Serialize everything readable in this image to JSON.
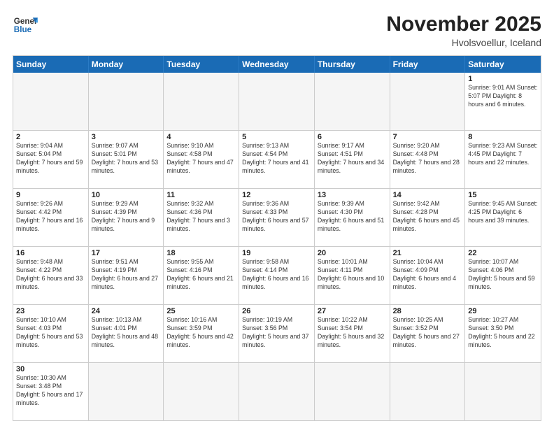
{
  "header": {
    "logo_general": "General",
    "logo_blue": "Blue",
    "month_title": "November 2025",
    "location": "Hvolsvoellur, Iceland"
  },
  "weekdays": [
    "Sunday",
    "Monday",
    "Tuesday",
    "Wednesday",
    "Thursday",
    "Friday",
    "Saturday"
  ],
  "rows": [
    [
      {
        "day": "",
        "empty": true,
        "info": ""
      },
      {
        "day": "",
        "empty": true,
        "info": ""
      },
      {
        "day": "",
        "empty": true,
        "info": ""
      },
      {
        "day": "",
        "empty": true,
        "info": ""
      },
      {
        "day": "",
        "empty": true,
        "info": ""
      },
      {
        "day": "",
        "empty": true,
        "info": ""
      },
      {
        "day": "1",
        "info": "Sunrise: 9:01 AM\nSunset: 5:07 PM\nDaylight: 8 hours\nand 6 minutes."
      }
    ],
    [
      {
        "day": "2",
        "info": "Sunrise: 9:04 AM\nSunset: 5:04 PM\nDaylight: 7 hours\nand 59 minutes."
      },
      {
        "day": "3",
        "info": "Sunrise: 9:07 AM\nSunset: 5:01 PM\nDaylight: 7 hours\nand 53 minutes."
      },
      {
        "day": "4",
        "info": "Sunrise: 9:10 AM\nSunset: 4:58 PM\nDaylight: 7 hours\nand 47 minutes."
      },
      {
        "day": "5",
        "info": "Sunrise: 9:13 AM\nSunset: 4:54 PM\nDaylight: 7 hours\nand 41 minutes."
      },
      {
        "day": "6",
        "info": "Sunrise: 9:17 AM\nSunset: 4:51 PM\nDaylight: 7 hours\nand 34 minutes."
      },
      {
        "day": "7",
        "info": "Sunrise: 9:20 AM\nSunset: 4:48 PM\nDaylight: 7 hours\nand 28 minutes."
      },
      {
        "day": "8",
        "info": "Sunrise: 9:23 AM\nSunset: 4:45 PM\nDaylight: 7 hours\nand 22 minutes."
      }
    ],
    [
      {
        "day": "9",
        "info": "Sunrise: 9:26 AM\nSunset: 4:42 PM\nDaylight: 7 hours\nand 16 minutes."
      },
      {
        "day": "10",
        "info": "Sunrise: 9:29 AM\nSunset: 4:39 PM\nDaylight: 7 hours\nand 9 minutes."
      },
      {
        "day": "11",
        "info": "Sunrise: 9:32 AM\nSunset: 4:36 PM\nDaylight: 7 hours\nand 3 minutes."
      },
      {
        "day": "12",
        "info": "Sunrise: 9:36 AM\nSunset: 4:33 PM\nDaylight: 6 hours\nand 57 minutes."
      },
      {
        "day": "13",
        "info": "Sunrise: 9:39 AM\nSunset: 4:30 PM\nDaylight: 6 hours\nand 51 minutes."
      },
      {
        "day": "14",
        "info": "Sunrise: 9:42 AM\nSunset: 4:28 PM\nDaylight: 6 hours\nand 45 minutes."
      },
      {
        "day": "15",
        "info": "Sunrise: 9:45 AM\nSunset: 4:25 PM\nDaylight: 6 hours\nand 39 minutes."
      }
    ],
    [
      {
        "day": "16",
        "info": "Sunrise: 9:48 AM\nSunset: 4:22 PM\nDaylight: 6 hours\nand 33 minutes."
      },
      {
        "day": "17",
        "info": "Sunrise: 9:51 AM\nSunset: 4:19 PM\nDaylight: 6 hours\nand 27 minutes."
      },
      {
        "day": "18",
        "info": "Sunrise: 9:55 AM\nSunset: 4:16 PM\nDaylight: 6 hours\nand 21 minutes."
      },
      {
        "day": "19",
        "info": "Sunrise: 9:58 AM\nSunset: 4:14 PM\nDaylight: 6 hours\nand 16 minutes."
      },
      {
        "day": "20",
        "info": "Sunrise: 10:01 AM\nSunset: 4:11 PM\nDaylight: 6 hours\nand 10 minutes."
      },
      {
        "day": "21",
        "info": "Sunrise: 10:04 AM\nSunset: 4:09 PM\nDaylight: 6 hours\nand 4 minutes."
      },
      {
        "day": "22",
        "info": "Sunrise: 10:07 AM\nSunset: 4:06 PM\nDaylight: 5 hours\nand 59 minutes."
      }
    ],
    [
      {
        "day": "23",
        "info": "Sunrise: 10:10 AM\nSunset: 4:03 PM\nDaylight: 5 hours\nand 53 minutes."
      },
      {
        "day": "24",
        "info": "Sunrise: 10:13 AM\nSunset: 4:01 PM\nDaylight: 5 hours\nand 48 minutes."
      },
      {
        "day": "25",
        "info": "Sunrise: 10:16 AM\nSunset: 3:59 PM\nDaylight: 5 hours\nand 42 minutes."
      },
      {
        "day": "26",
        "info": "Sunrise: 10:19 AM\nSunset: 3:56 PM\nDaylight: 5 hours\nand 37 minutes."
      },
      {
        "day": "27",
        "info": "Sunrise: 10:22 AM\nSunset: 3:54 PM\nDaylight: 5 hours\nand 32 minutes."
      },
      {
        "day": "28",
        "info": "Sunrise: 10:25 AM\nSunset: 3:52 PM\nDaylight: 5 hours\nand 27 minutes."
      },
      {
        "day": "29",
        "info": "Sunrise: 10:27 AM\nSunset: 3:50 PM\nDaylight: 5 hours\nand 22 minutes."
      }
    ],
    [
      {
        "day": "30",
        "info": "Sunrise: 10:30 AM\nSunset: 3:48 PM\nDaylight: 5 hours\nand 17 minutes."
      },
      {
        "day": "",
        "empty": true,
        "info": ""
      },
      {
        "day": "",
        "empty": true,
        "info": ""
      },
      {
        "day": "",
        "empty": true,
        "info": ""
      },
      {
        "day": "",
        "empty": true,
        "info": ""
      },
      {
        "day": "",
        "empty": true,
        "info": ""
      },
      {
        "day": "",
        "empty": true,
        "info": ""
      }
    ]
  ]
}
